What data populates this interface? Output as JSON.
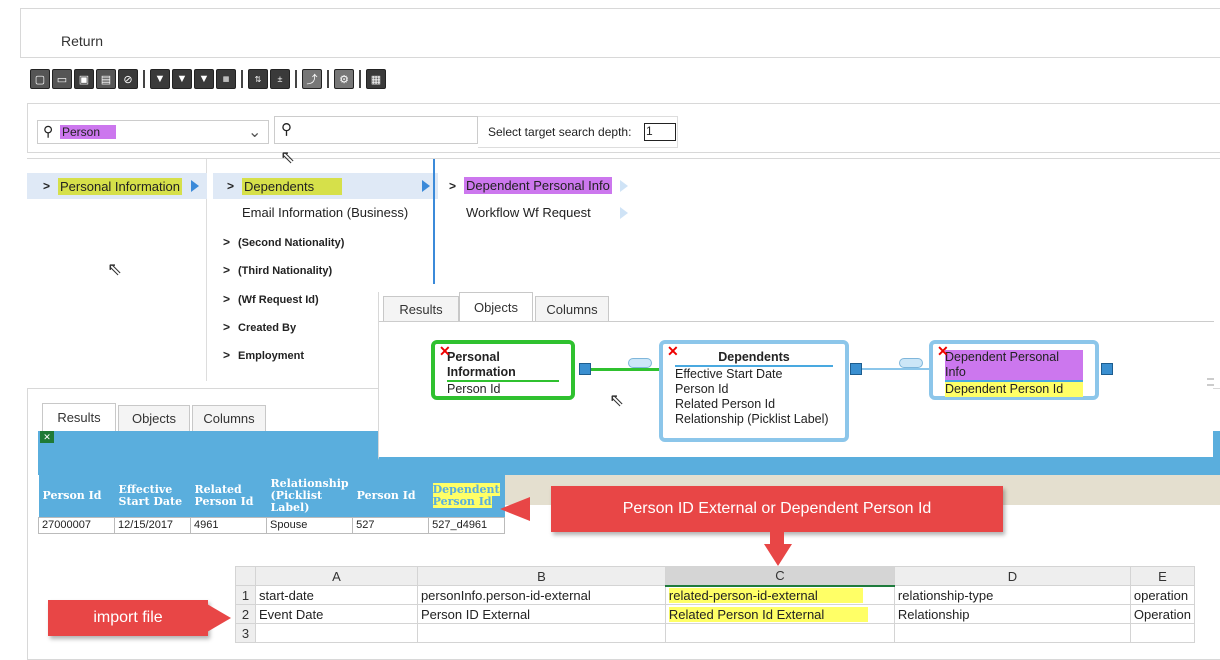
{
  "header": {
    "return_label": "Return"
  },
  "toolbar": {
    "icons": [
      "new-icon",
      "open-icon",
      "save-icon",
      "save-as-icon",
      "cancel-icon",
      "filter-icon",
      "filter-settings-icon",
      "filter-help-icon",
      "query-icon",
      "sort-az-icon",
      "calculator-icon",
      "export-icon",
      "settings-icon",
      "schedule-icon"
    ]
  },
  "search": {
    "entity_value": "Person",
    "field_search_value": "",
    "depth_label": "Select target search depth:",
    "depth_value": "1"
  },
  "tree": {
    "col1": [
      {
        "label": "Personal Information"
      }
    ],
    "col2": [
      {
        "label": "Dependents"
      },
      {
        "label": "Email Information (Business)"
      },
      {
        "label": "(Second Nationality)"
      },
      {
        "label": "(Third Nationality)"
      },
      {
        "label": "(Wf Request Id)"
      },
      {
        "label": "Created By"
      },
      {
        "label": "Employment"
      }
    ],
    "col3": [
      {
        "label": "Dependent Personal Info"
      },
      {
        "label": "Workflow Wf Request"
      }
    ]
  },
  "upper_tabs": {
    "results": "Results",
    "objects": "Objects",
    "columns": "Columns"
  },
  "diagram": {
    "node1": {
      "title": "Personal Information",
      "fields": [
        "Person Id"
      ]
    },
    "node2": {
      "title": "Dependents",
      "fields": [
        "Effective Start Date",
        "Person Id",
        "Related Person Id",
        "Relationship (Picklist Label)"
      ]
    },
    "node3": {
      "title": "Dependent Personal Info",
      "fields": [
        "Dependent Person Id"
      ]
    }
  },
  "lower_tabs": {
    "results": "Results",
    "objects": "Objects",
    "columns": "Columns"
  },
  "results_table": {
    "headers": [
      "Person Id",
      "Effective Start Date",
      "Related Person Id",
      "Relationship (Picklist Label)",
      "Person Id",
      "Dependent Person Id"
    ],
    "rows": [
      [
        "27000007",
        "12/15/2017",
        "4961",
        "Spouse",
        "527",
        "527_d4961"
      ]
    ]
  },
  "callouts": {
    "person_id": "Person ID External or  Dependent Person Id",
    "import_file": "import file"
  },
  "spreadsheet": {
    "columns": [
      "A",
      "B",
      "C",
      "D",
      "E"
    ],
    "rows": [
      {
        "num": "1",
        "cells": [
          "start-date",
          "personInfo.person-id-external",
          "related-person-id-external",
          "relationship-type",
          "operation"
        ]
      },
      {
        "num": "2",
        "cells": [
          "Event Date",
          "Person ID External",
          "Related Person Id External",
          "Relationship",
          "Operation"
        ]
      },
      {
        "num": "3",
        "cells": [
          "",
          "",
          "",
          "",
          ""
        ]
      }
    ]
  },
  "colors": {
    "accent_blue": "#5aaedd",
    "callout_red": "#e84646",
    "highlight_yellow": "#ffff66",
    "highlight_purple": "#cc77ee",
    "node_green": "#2fc12f"
  }
}
